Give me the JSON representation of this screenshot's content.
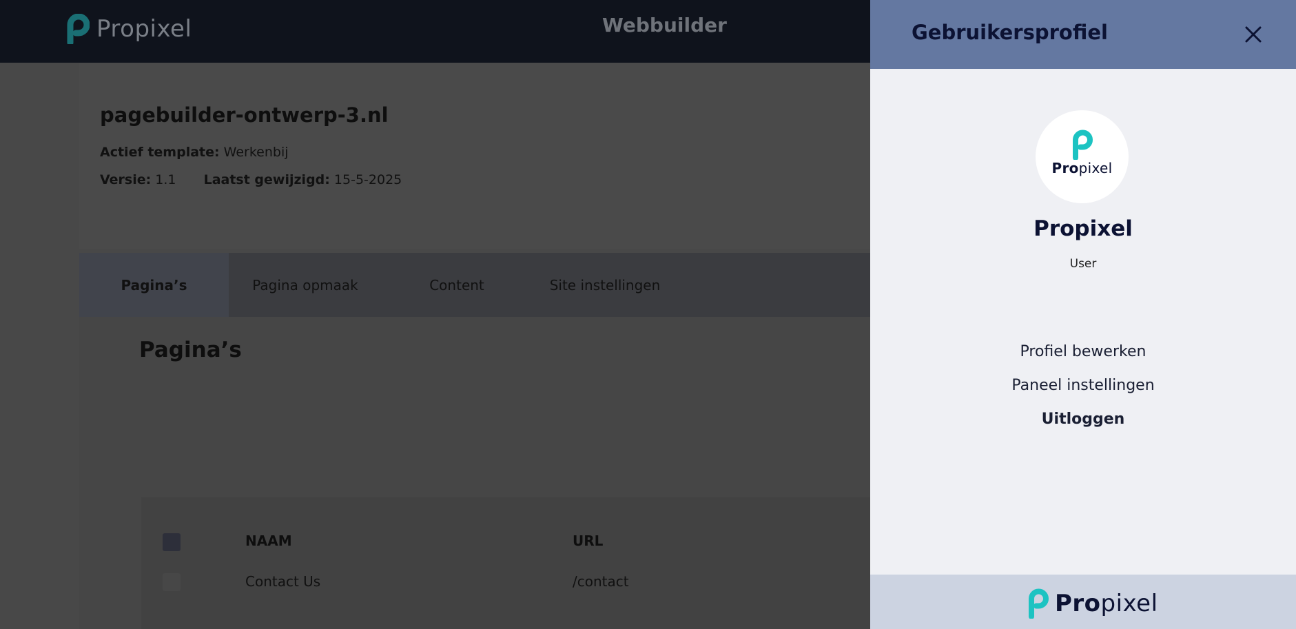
{
  "header": {
    "brand": "Propixel",
    "app_title": "Webbuilder"
  },
  "site": {
    "domain": "pagebuilder-ontwerp-3.nl",
    "template_label": "Actief template:",
    "template_value": "Werkenbij",
    "version_label": "Versie:",
    "version_value": "1.1",
    "modified_label": "Laatst gewijzigd:",
    "modified_value": "15-5-2025"
  },
  "tabs": [
    {
      "label": "Pagina’s",
      "active": true
    },
    {
      "label": "Pagina opmaak"
    },
    {
      "label": "Content"
    },
    {
      "label": "Site instellingen"
    }
  ],
  "pages_section": {
    "title": "Pagina’s",
    "columns": [
      "NAAM",
      "URL"
    ],
    "rows": [
      {
        "name": "Contact Us",
        "url": "/contact"
      }
    ]
  },
  "drawer": {
    "title": "Gebruikersprofiel",
    "avatar_text_pro": "Pro",
    "avatar_text_pixel": "pixel",
    "user_name": "Propixel",
    "user_role": "User",
    "menu": [
      {
        "label": "Profiel bewerken"
      },
      {
        "label": "Paneel instellingen"
      },
      {
        "label": "Uitloggen"
      }
    ],
    "footer_brand_pro": "Pro",
    "footer_brand_pixel": "pixel"
  },
  "colors": {
    "brand_teal": "#1cc3c2",
    "drawer_header": "#6478a1",
    "drawer_bg": "#eff0f4",
    "drawer_footer": "#ccd3e1",
    "topbar": "#0f131c",
    "overlay": "#484848"
  }
}
